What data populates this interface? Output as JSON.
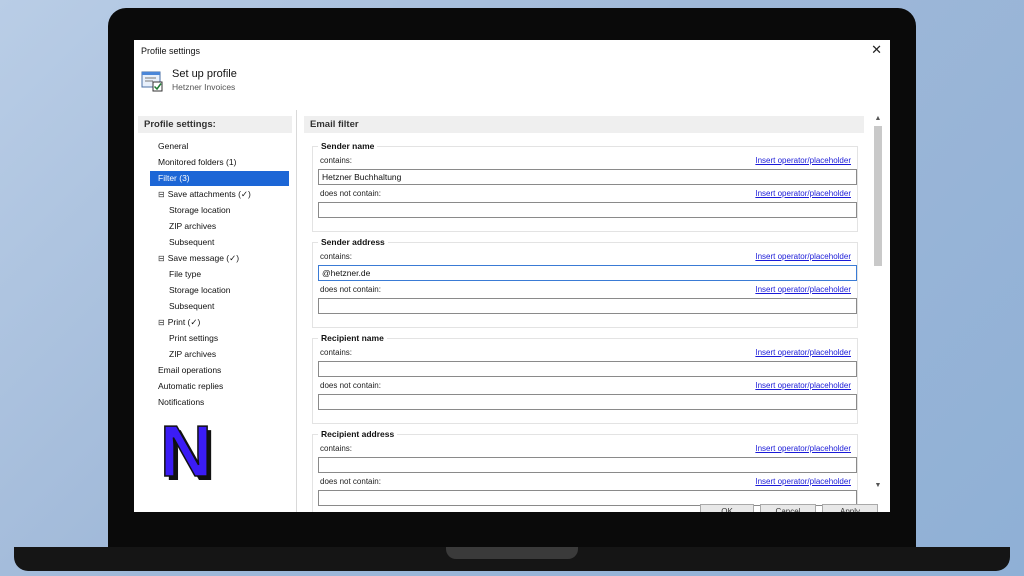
{
  "window": {
    "title": "Profile settings",
    "close": "✕"
  },
  "header": {
    "title": "Set up profile",
    "subtitle": "Hetzner Invoices"
  },
  "sidebar": {
    "heading": "Profile settings:",
    "items": [
      {
        "label": "General"
      },
      {
        "label": "Monitored folders (1)"
      },
      {
        "label": "Filter (3)"
      },
      {
        "label": "Save attachments (✓)"
      },
      {
        "label": "Storage location"
      },
      {
        "label": "ZIP archives"
      },
      {
        "label": "Subsequent"
      },
      {
        "label": "Save message (✓)"
      },
      {
        "label": "File type"
      },
      {
        "label": "Storage location"
      },
      {
        "label": "Subsequent"
      },
      {
        "label": "Print  (✓)"
      },
      {
        "label": "Print settings"
      },
      {
        "label": "ZIP archives"
      },
      {
        "label": "Email operations"
      },
      {
        "label": "Automatic replies"
      },
      {
        "label": "Notifications"
      }
    ],
    "logo_letter": "N"
  },
  "main": {
    "heading": "Email filter",
    "link_label": "Insert operator/placeholder",
    "contains_label": "contains:",
    "not_contains_label": "does not contain:",
    "groups": [
      {
        "title": "Sender name",
        "contains": "Hetzner Buchhaltung",
        "not_contains": ""
      },
      {
        "title": "Sender address",
        "contains": "@hetzner.de",
        "not_contains": ""
      },
      {
        "title": "Recipient name",
        "contains": "",
        "not_contains": ""
      },
      {
        "title": "Recipient address",
        "contains": "",
        "not_contains": ""
      }
    ]
  },
  "buttons": {
    "ok": "OK",
    "cancel": "Cancel",
    "apply": "Apply"
  },
  "colors": {
    "selection": "#1c66d6",
    "link": "#1a1ad8",
    "logo_fill": "#3b1cf5"
  }
}
